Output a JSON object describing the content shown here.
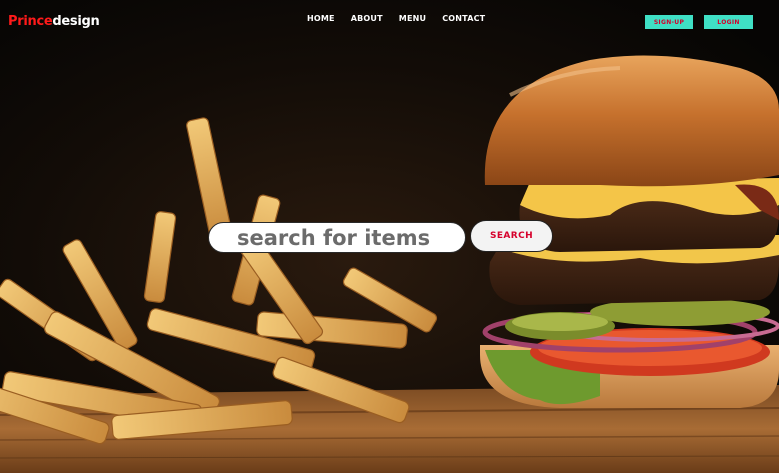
{
  "brand": {
    "part1": "Prince",
    "part2": "design"
  },
  "nav": {
    "items": [
      "HOME",
      "ABOUT",
      "MENU",
      "CONTACT"
    ]
  },
  "auth": {
    "signup": "SIGN-UP",
    "login": "LOGIN"
  },
  "search": {
    "placeholder": "search for items",
    "button": "SEARCH"
  },
  "colors": {
    "brand_red": "#ff1a1a",
    "button_teal": "#3fe0c5",
    "button_text_red": "#d3002b"
  },
  "hero_image": "burger-and-fries-photo"
}
